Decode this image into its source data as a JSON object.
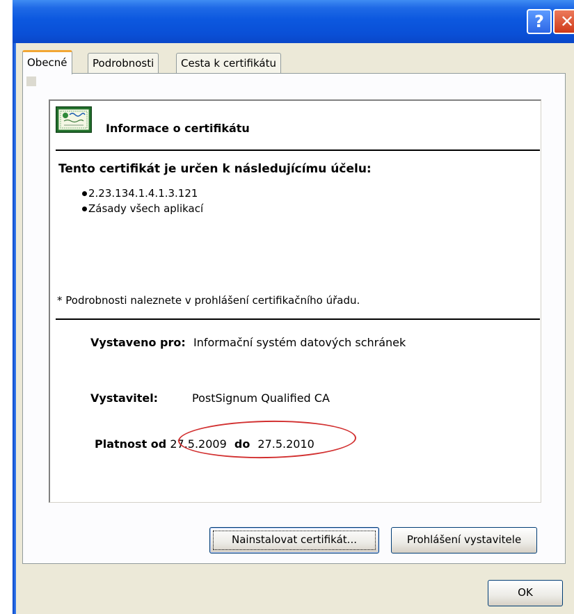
{
  "titlebar": {
    "help_label": "?",
    "close_label": "✕"
  },
  "tabs": [
    {
      "label": "Obecné",
      "active": true
    },
    {
      "label": "Podrobnosti",
      "active": false
    },
    {
      "label": "Cesta k certifikátu",
      "active": false
    }
  ],
  "info": {
    "header": "Informace o certifikátu",
    "purpose_title": "Tento certifikát je určen k následujícímu účelu:",
    "purposes": [
      "2.23.134.1.4.1.3.121",
      "Zásady všech aplikací"
    ],
    "note": "* Podrobnosti naleznete v prohlášení certifikačního úřadu.",
    "issued_to_label": "Vystaveno pro:",
    "issued_to_value": "Informační systém datových schránek",
    "issuer_label": "Vystavitel:",
    "issuer_value": "PostSignum Qualified CA",
    "valid_from_label": "Platnost od",
    "valid_from": "27.5.2009",
    "valid_to_label": "do",
    "valid_to": "27.5.2010"
  },
  "buttons": {
    "install": "Nainstalovat certifikát...",
    "statement": "Prohlášení vystavitele",
    "ok": "OK"
  },
  "colors": {
    "titlebar": "#0c58df",
    "dialog_bg": "#ece9d8",
    "active_tab_accent": "#f2a634",
    "annotation_ellipse": "#d23030"
  }
}
